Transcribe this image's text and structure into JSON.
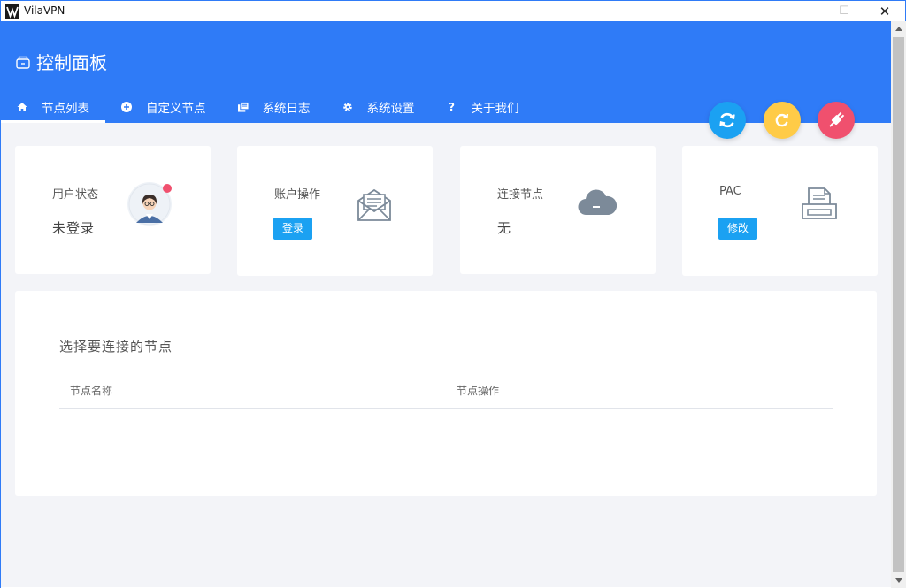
{
  "window": {
    "app_title": "VilaVPN",
    "minimize_glyph": "—",
    "maximize_glyph": "☐",
    "close_glyph": "✕"
  },
  "header": {
    "title": "控制面板",
    "title_icon": "dashboard-icon",
    "background_color": "#2f7bf7"
  },
  "tabs": [
    {
      "label": "节点列表",
      "icon": "home-icon",
      "active": true
    },
    {
      "label": "自定义节点",
      "icon": "plus-circle-icon",
      "active": false
    },
    {
      "label": "系统日志",
      "icon": "log-icon",
      "active": false
    },
    {
      "label": "系统设置",
      "icon": "gear-icon",
      "active": false
    },
    {
      "label": "关于我们",
      "icon": "question-icon",
      "active": false
    }
  ],
  "actions": {
    "refresh_color": "#1ba1f2",
    "reload_color": "#ffcb47",
    "disconnect_color": "#f0506e"
  },
  "cards": {
    "user_status": {
      "label": "用户状态",
      "value": "未登录",
      "icon": "avatar-icon"
    },
    "account": {
      "label": "账户操作",
      "button": "登录",
      "icon": "mail-icon"
    },
    "connection": {
      "label": "连接节点",
      "value": "无",
      "icon": "cloud-icon"
    },
    "pac": {
      "label": "PAC",
      "button": "修改",
      "icon": "printer-icon"
    }
  },
  "nodes": {
    "title": "选择要连接的节点",
    "columns": [
      "节点名称",
      "节点操作"
    ],
    "rows": []
  }
}
